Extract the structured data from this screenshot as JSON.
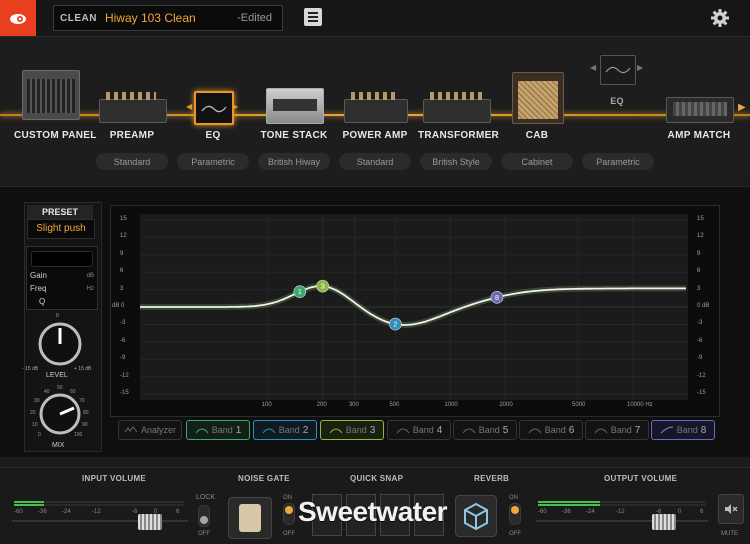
{
  "header": {
    "category": "CLEAN",
    "preset_name": "Hiway 103 Clean",
    "edited": "-Edited"
  },
  "chain": {
    "blocks": [
      {
        "label": "CUSTOM PANEL"
      },
      {
        "label": "PREAMP",
        "sub": "Standard"
      },
      {
        "label": "EQ",
        "sub": "Parametric"
      },
      {
        "label": "TONE STACK",
        "sub": "British Hiway"
      },
      {
        "label": "POWER AMP",
        "sub": "Standard"
      },
      {
        "label": "TRANSFORMER",
        "sub": "British Style"
      },
      {
        "label": "CAB",
        "sub": "Cabinet"
      },
      {
        "label": "EQ",
        "sub": "Parametric"
      },
      {
        "label": "AMP MATCH"
      }
    ]
  },
  "eq": {
    "preset_header": "PRESET",
    "preset_value": "Slight push",
    "params": {
      "gain": "Gain",
      "gain_unit": "dB",
      "freq": "Freq",
      "freq_unit": "Hz",
      "q": "Q"
    },
    "knobs": {
      "level": {
        "label": "LEVEL",
        "min": "- 15 dB",
        "max": "+ 15 dB",
        "mid": "0"
      },
      "mix": {
        "label": "MIX",
        "ticks": [
          "0",
          "10",
          "20",
          "30",
          "40",
          "50",
          "60",
          "70",
          "80",
          "90",
          "100"
        ]
      }
    },
    "y_ticks": [
      "15",
      "12",
      "9",
      "6",
      "3",
      "dB 0",
      "-3",
      "-6",
      "-9",
      "-12",
      "-15"
    ],
    "y_ticks_right": [
      "15",
      "12",
      "9",
      "6",
      "3",
      "0 dB",
      "-3",
      "-6",
      "-9",
      "-12",
      "-15"
    ],
    "x_ticks": [
      "100",
      "200",
      "300",
      "500",
      "1000",
      "2000",
      "5000",
      "10000 Hz"
    ],
    "nodes": [
      {
        "id": "1",
        "freq": 150,
        "gain": 0,
        "color": "#3aa870"
      },
      {
        "id": "3",
        "freq": 200,
        "gain": 3.5,
        "color": "#8ab845"
      },
      {
        "id": "2",
        "freq": 500,
        "gain": -2,
        "color": "#2f8fb8"
      },
      {
        "id": "8",
        "freq": 1800,
        "gain": 3,
        "color": "#6a6ab8"
      }
    ],
    "bands": [
      {
        "label": "Analyzer",
        "num": ""
      },
      {
        "label": "Band",
        "num": "1",
        "color": "#3aa870"
      },
      {
        "label": "Band",
        "num": "2",
        "color": "#2f8fb8"
      },
      {
        "label": "Band",
        "num": "3",
        "color": "#8ab845"
      },
      {
        "label": "Band",
        "num": "4"
      },
      {
        "label": "Band",
        "num": "5"
      },
      {
        "label": "Band",
        "num": "6"
      },
      {
        "label": "Band",
        "num": "7"
      },
      {
        "label": "Band",
        "num": "8",
        "color": "#6a6ab8"
      }
    ]
  },
  "footer": {
    "input_volume": "INPUT VOLUME",
    "noise_gate": "NOISE GATE",
    "quick_snap": "QUICK SNAP",
    "reverb": "REVERB",
    "output_volume": "OUTPUT VOLUME",
    "lock": "LOCK",
    "off": "OFF",
    "on": "ON",
    "mute": "MUTE",
    "meter_ticks": [
      "-60",
      "-36",
      "-24",
      "-12",
      "-6",
      "0",
      "6"
    ],
    "watermark": "Sweetwater"
  }
}
